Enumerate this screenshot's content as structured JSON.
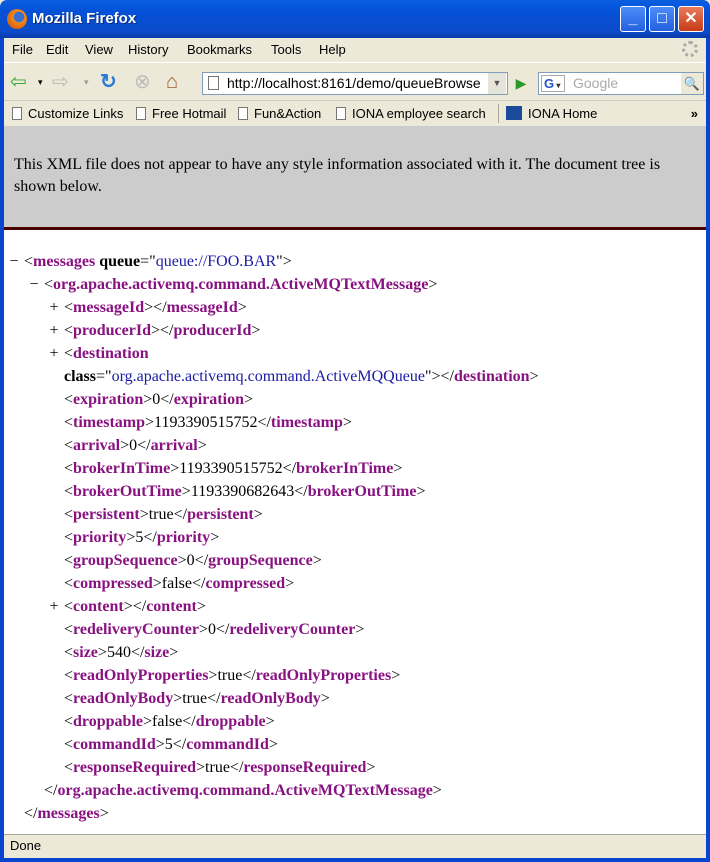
{
  "window": {
    "title": "Mozilla Firefox"
  },
  "menu": [
    "File",
    "Edit",
    "View",
    "History",
    "Bookmarks",
    "Tools",
    "Help"
  ],
  "address": {
    "url": "http://localhost:8161/demo/queueBrowse"
  },
  "search": {
    "engine": "G",
    "placeholder": "Google"
  },
  "bookmarks": [
    "Customize Links",
    "Free Hotmail",
    "Fun&Action",
    "IONA employee search",
    "IONA Home"
  ],
  "bookmarks_overflow": "»",
  "notice": "This XML file does not appear to have any style information associated with it. The document tree is shown below.",
  "xml_lines": [
    {
      "level": 0,
      "toggle": "−",
      "type": "open",
      "tag": "messages",
      "attr": "queue",
      "value": "queue://FOO.BAR"
    },
    {
      "level": 1,
      "toggle": "−",
      "type": "open",
      "tag": "org.apache.activemq.command.ActiveMQTextMessage"
    },
    {
      "level": 2,
      "toggle": "+",
      "type": "leaf",
      "tag": "messageId",
      "text": ""
    },
    {
      "level": 2,
      "toggle": "+",
      "type": "leaf",
      "tag": "producerId",
      "text": ""
    },
    {
      "level": 2,
      "toggle": "+",
      "type": "openbare",
      "tag": "destination"
    },
    {
      "level": 2,
      "toggle": "",
      "type": "attrclose",
      "tag": "destination",
      "attr": "class",
      "value": "org.apache.activemq.command.ActiveMQQueue"
    },
    {
      "level": 2,
      "toggle": "",
      "type": "leaf",
      "tag": "expiration",
      "text": "0"
    },
    {
      "level": 2,
      "toggle": "",
      "type": "leaf",
      "tag": "timestamp",
      "text": "1193390515752"
    },
    {
      "level": 2,
      "toggle": "",
      "type": "leaf",
      "tag": "arrival",
      "text": "0"
    },
    {
      "level": 2,
      "toggle": "",
      "type": "leaf",
      "tag": "brokerInTime",
      "text": "1193390515752"
    },
    {
      "level": 2,
      "toggle": "",
      "type": "leaf",
      "tag": "brokerOutTime",
      "text": "1193390682643"
    },
    {
      "level": 2,
      "toggle": "",
      "type": "leaf",
      "tag": "persistent",
      "text": "true"
    },
    {
      "level": 2,
      "toggle": "",
      "type": "leaf",
      "tag": "priority",
      "text": "5"
    },
    {
      "level": 2,
      "toggle": "",
      "type": "leaf",
      "tag": "groupSequence",
      "text": "0"
    },
    {
      "level": 2,
      "toggle": "",
      "type": "leaf",
      "tag": "compressed",
      "text": "false"
    },
    {
      "level": 2,
      "toggle": "+",
      "type": "leaf",
      "tag": "content",
      "text": ""
    },
    {
      "level": 2,
      "toggle": "",
      "type": "leaf",
      "tag": "redeliveryCounter",
      "text": "0"
    },
    {
      "level": 2,
      "toggle": "",
      "type": "leaf",
      "tag": "size",
      "text": "540"
    },
    {
      "level": 2,
      "toggle": "",
      "type": "leaf",
      "tag": "readOnlyProperties",
      "text": "true"
    },
    {
      "level": 2,
      "toggle": "",
      "type": "leaf",
      "tag": "readOnlyBody",
      "text": "true"
    },
    {
      "level": 2,
      "toggle": "",
      "type": "leaf",
      "tag": "droppable",
      "text": "false"
    },
    {
      "level": 2,
      "toggle": "",
      "type": "leaf",
      "tag": "commandId",
      "text": "5"
    },
    {
      "level": 2,
      "toggle": "",
      "type": "leaf",
      "tag": "responseRequired",
      "text": "true"
    },
    {
      "level": 1,
      "toggle": "",
      "type": "close",
      "tag": "org.apache.activemq.command.ActiveMQTextMessage"
    },
    {
      "level": 0,
      "toggle": "",
      "type": "close",
      "tag": "messages"
    }
  ],
  "status": "Done"
}
